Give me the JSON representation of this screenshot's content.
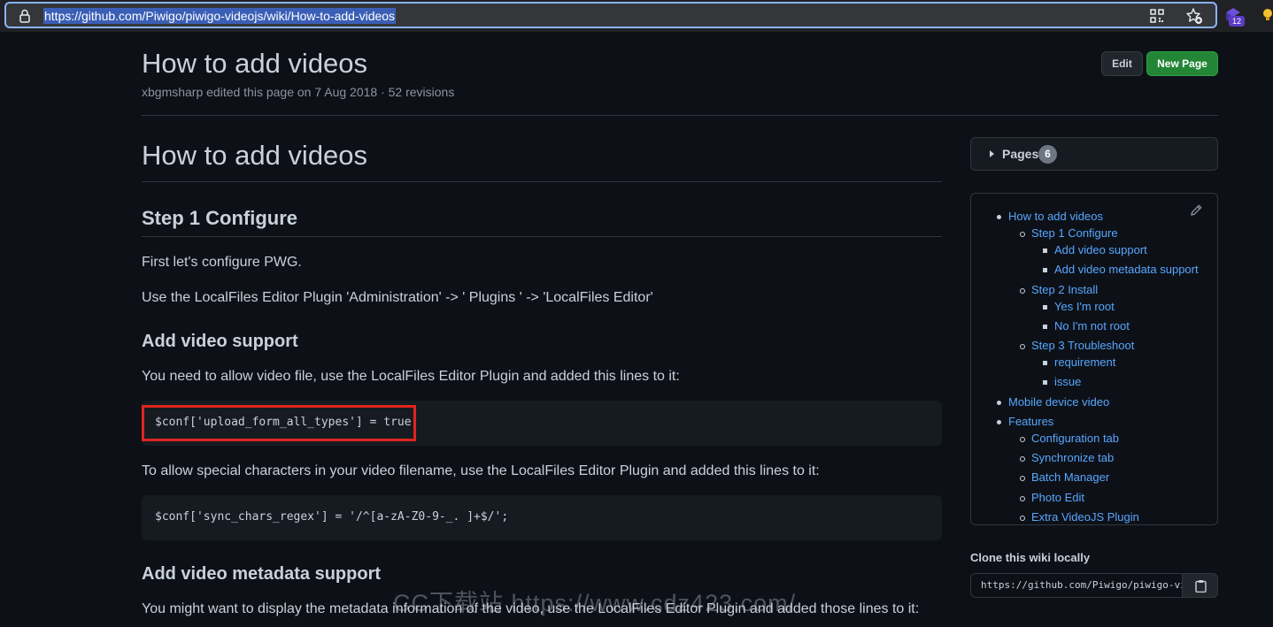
{
  "browser": {
    "url": "https://github.com/Piwigo/piwigo-videojs/wiki/How-to-add-videos",
    "extension_badge": "12",
    "icons": [
      "lock-icon",
      "qr-code-icon",
      "favorite-star-icon",
      "extension-icon",
      "extension-icon-2"
    ]
  },
  "header": {
    "title": "How to add videos",
    "meta": "xbgmsharp edited this page on 7 Aug 2018 · 52 revisions",
    "edit_label": "Edit",
    "new_page_label": "New Page"
  },
  "content": {
    "h1": "How to add videos",
    "step1_heading": "Step 1 Configure",
    "p_configure": "First let's configure PWG.",
    "p_use_plugin": "Use the LocalFiles Editor Plugin 'Administration' -> ' Plugins ' -> 'LocalFiles Editor'",
    "add_video_support_heading": "Add video support",
    "p_allow_video": "You need to allow video file, use the LocalFiles Editor Plugin and added this lines to it:",
    "code_upload_types": "$conf['upload_form_all_types'] = true;",
    "p_special_chars": "To allow special characters in your video filename, use the LocalFiles Editor Plugin and added this lines to it:",
    "code_sync_chars": "$conf['sync_chars_regex'] = '/^[a-zA-Z0-9-_. ]+$/';",
    "add_metadata_heading": "Add video metadata support",
    "p_metadata": "You might want to display the metadata information of the video, use the LocalFiles Editor Plugin and added those lines to it:"
  },
  "watermark": "CC下载站 https://www.cdz423.com/",
  "sidebar": {
    "pages_label": "Pages",
    "pages_count": "6",
    "toc": [
      {
        "label": "How to add videos",
        "level": 1
      },
      {
        "label": "Step 1 Configure",
        "level": 2
      },
      {
        "label": "Add video support",
        "level": 3
      },
      {
        "label": "Add video metadata support",
        "level": 3
      },
      {
        "label": "Step 2 Install",
        "level": 2
      },
      {
        "label": "Yes I'm root",
        "level": 3
      },
      {
        "label": "No I'm not root",
        "level": 3
      },
      {
        "label": "Step 3 Troubleshoot",
        "level": 2
      },
      {
        "label": "requirement",
        "level": 3
      },
      {
        "label": "issue",
        "level": 3
      },
      {
        "label": "Mobile device video",
        "level": 1
      },
      {
        "label": "Features",
        "level": 1
      },
      {
        "label": "Configuration tab",
        "level": 2
      },
      {
        "label": "Synchronize tab",
        "level": 2
      },
      {
        "label": "Batch Manager",
        "level": 2
      },
      {
        "label": "Photo Edit",
        "level": 2
      },
      {
        "label": "Extra VideoJS Plugin",
        "level": 2
      }
    ],
    "clone_title": "Clone this wiki locally",
    "clone_url": "https://github.com/Piwigo/piwigo-videojs.wiki.git"
  },
  "colors": {
    "background": "#0d1117",
    "link": "#58a6ff",
    "primary_button": "#238636",
    "highlight_box": "#e0241f"
  }
}
